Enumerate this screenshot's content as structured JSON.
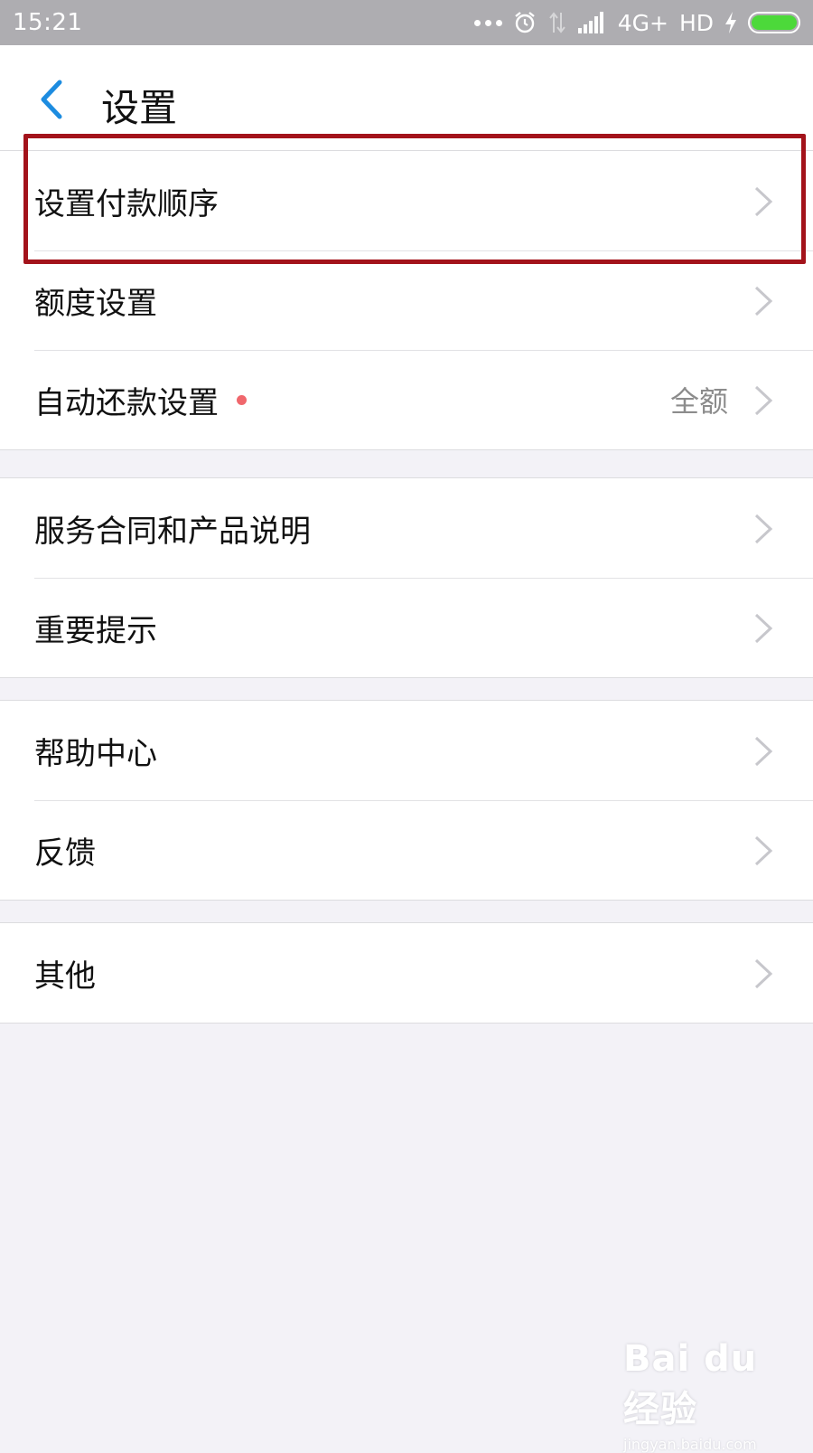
{
  "status_bar": {
    "time": "15:21",
    "network": "4G+",
    "hd": "HD",
    "icons": [
      "more-dots-icon",
      "alarm-icon",
      "data-arrows-icon",
      "signal-icon",
      "charging-icon",
      "battery-icon"
    ],
    "battery_level": 1.0,
    "battery_color": "#4cd93a"
  },
  "header": {
    "title": "设置",
    "back_icon": "chevron-left-icon",
    "accent_color": "#1d8ce0"
  },
  "groups": [
    {
      "items": [
        {
          "label": "设置付款顺序"
        },
        {
          "label": "额度设置"
        },
        {
          "label": "自动还款设置",
          "value": "全额",
          "badge": "red-dot"
        }
      ]
    },
    {
      "items": [
        {
          "label": "服务合同和产品说明"
        },
        {
          "label": "重要提示"
        }
      ]
    },
    {
      "items": [
        {
          "label": "帮助中心"
        },
        {
          "label": "反馈"
        }
      ]
    },
    {
      "items": [
        {
          "label": "其他"
        }
      ]
    }
  ],
  "highlight": {
    "target": "设置付款顺序",
    "color": "#a3131b"
  },
  "watermark": {
    "logo": "Bai du 经验",
    "url": "jingyan.baidu.com"
  }
}
